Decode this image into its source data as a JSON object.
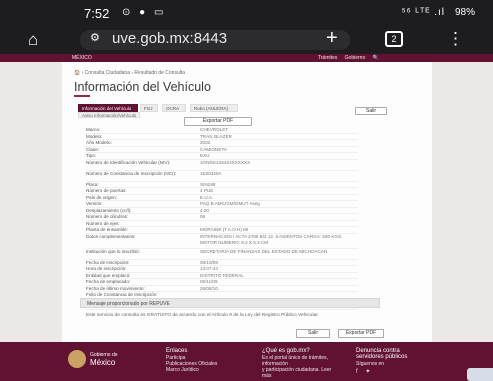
{
  "status_bar": {
    "time": "7:52",
    "icons": "⊙ ● ▭",
    "signal": "⁵⁶ ᴸᵀᴱ .ıl",
    "battery": "98%"
  },
  "browser": {
    "url": "uve.gob.mx:8443",
    "tab_count": "2"
  },
  "gov_nav": {
    "logo": "MÉXICO",
    "links": [
      "Trámites",
      "Gobierno",
      "🔍"
    ]
  },
  "breadcrumb": "🏠 › Consulta Ciudadana › Resultado de Consulta",
  "page_title": "Información del Vehículo",
  "tabs": [
    "Información del Vehículo",
    "FGJ",
    "OCRA",
    "Robo (ANUCRA)"
  ],
  "subtab": "Aviso Información/Vehículo",
  "buttons": {
    "salir": "Salir",
    "exportar": "Exportar PDF"
  },
  "vehicle_info": [
    {
      "label": "Marca:",
      "value": "CHEVROLET"
    },
    {
      "label": "Modelo:",
      "value": "TRAIL BLAZER"
    },
    {
      "label": "Año Modelo:",
      "value": "2002"
    },
    {
      "label": "Clase:",
      "value": "CAMIONETA"
    },
    {
      "label": "Tipo:",
      "value": "EXU"
    },
    {
      "label": "Número de Identificación Vehicular (NIV):",
      "value": "1GNDS13S422XXXXXX"
    },
    {
      "label": "Número de Constancia de Inscripción (NCI):",
      "value": "1E00340A"
    },
    {
      "label": "Placa:",
      "value": "SIN188"
    },
    {
      "label": "Número de puertas:",
      "value": "4 PUE"
    },
    {
      "label": "País de origen:",
      "value": "E.U.A."
    },
    {
      "label": "Versión:",
      "value": "PAQ B AMC/GM/GMUT Aseg"
    },
    {
      "label": "Desplazamiento (cc/l):",
      "value": "4.20"
    },
    {
      "label": "Número de cilindros:",
      "value": "06"
    },
    {
      "label": "Número de ejes:",
      "value": ""
    },
    {
      "label": "Planta de ensamble:",
      "value": "MORAINE (T.A.O.H) MI"
    },
    {
      "label": "Datos complementarios:",
      "value": "INTERNACION / ACTA 2786 B/2 12. 5 ASIENTOS CARGA: 530 KGS. MOTOR NUMERO: 8.2 X 5.3 CM"
    },
    {
      "label": "Institución que lo inscribió:",
      "value": "SECRETARIA DE FINANZAS DEL ESTADO DE MICHOACAN"
    },
    {
      "label": "Fecha de inscripción:",
      "value": "09/10/08"
    },
    {
      "label": "Hora de inscripción:",
      "value": "13:07:44"
    },
    {
      "label": "Entidad que emplacó:",
      "value": "DISTRITO FEDERAL"
    },
    {
      "label": "Fecha de emplacado:",
      "value": "05/11/09"
    },
    {
      "label": "Fecha de último movimiento:",
      "value": "26/08/10"
    },
    {
      "label": "Folio de Constancia de Inscripción:",
      "value": ""
    },
    {
      "label": "Observaciones:",
      "value": "0"
    }
  ],
  "message_box": "Mensaje proporcionado por REPUVE",
  "disclaimer": "Este servicio de consulta es GRATUITO de acuerdo con el Artículo 9 de la Ley del Registro Público Vehicular.",
  "footer": {
    "brand_line1": "Gobierno de",
    "brand_line2": "México",
    "col1_head": "Enlaces",
    "col1_items": [
      "Participa",
      "Publicaciones Oficiales",
      "Marco Jurídico"
    ],
    "col2_head": "¿Qué es gob.mx?",
    "col2_items": [
      "Es el portal único de trámites, información",
      "y participación ciudadana. Leer más"
    ],
    "col3_head": "Denuncia contra servidores públicos",
    "col3_items": [
      "Síguenos en"
    ],
    "social": "f ✦"
  }
}
